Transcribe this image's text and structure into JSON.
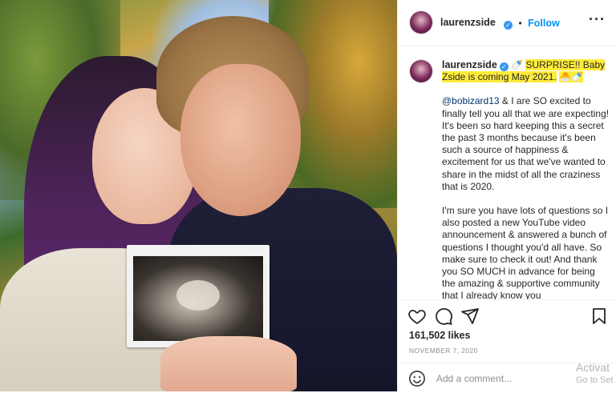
{
  "post": {
    "username": "laurenzside",
    "verified_icon": "✓",
    "follow_label": "Follow",
    "more_label": "···"
  },
  "caption": {
    "username": "laurenzside",
    "emoji_a": "🍼",
    "highlight": "SURPRISE!! Baby Zside is coming May 2021.",
    "emoji_b": "🐣🍼",
    "mention": "@bobizard13",
    "p1_rest": " & I are SO excited to finally tell you all that we are expecting! It's been so hard keeping this a secret the past 3 months because it's been such a source of happiness & excitement for us that we've wanted to share in the midst of all the craziness that is 2020.",
    "p2": "I'm sure you have lots of questions so I also posted a new YouTube video announcement & answered a bunch of questions I thought you'd all have. So make sure to check it out! And thank you SO MUCH in advance for being the amazing & supportive community that I already know you"
  },
  "stats": {
    "likes": "161,502 likes",
    "date": "NOVEMBER 7, 2020"
  },
  "comment": {
    "placeholder": "Add a comment..."
  },
  "watermark": {
    "line1": "Activat",
    "line2": "Go to Set"
  },
  "colors": {
    "follow": "#0095f6",
    "highlight": "#ffeb3b",
    "verified": "#3897f0"
  },
  "icons": {
    "like": "heart-icon",
    "comment": "comment-icon",
    "share": "share-icon",
    "save": "bookmark-icon",
    "emoji": "smiley-icon"
  }
}
